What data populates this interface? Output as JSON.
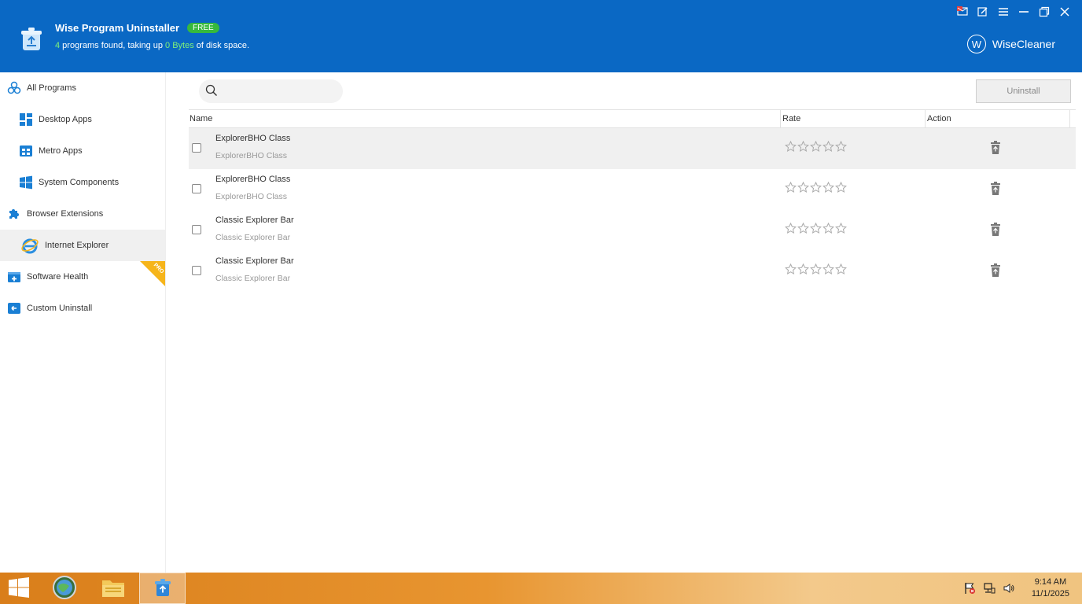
{
  "header": {
    "title": "Wise Program Uninstaller",
    "badge": "FREE",
    "subtitle_count": "4",
    "subtitle_mid": " programs found, taking up ",
    "subtitle_size": "0 Bytes",
    "subtitle_end": " of disk space.",
    "brand": "WiseCleaner",
    "brand_letter": "W"
  },
  "sidebar": {
    "items": [
      {
        "label": "All Programs",
        "icon": "cubes-icon"
      },
      {
        "label": "Desktop Apps",
        "icon": "desktop-apps-icon"
      },
      {
        "label": "Metro Apps",
        "icon": "metro-apps-icon"
      },
      {
        "label": "System Components",
        "icon": "windows-icon"
      },
      {
        "label": "Browser Extensions",
        "icon": "puzzle-icon"
      },
      {
        "label": "Internet Explorer",
        "icon": "ie-icon"
      },
      {
        "label": "Software Health",
        "icon": "health-icon"
      },
      {
        "label": "Custom Uninstall",
        "icon": "custom-uninstall-icon"
      }
    ],
    "pro_badge": "PRO"
  },
  "toolbar": {
    "search_placeholder": "",
    "uninstall_label": "Uninstall"
  },
  "table": {
    "headers": {
      "name": "Name",
      "rate": "Rate",
      "action": "Action"
    },
    "rows": [
      {
        "name": "ExplorerBHO Class",
        "sub": "ExplorerBHO Class",
        "rating": 0
      },
      {
        "name": "ExplorerBHO Class",
        "sub": "ExplorerBHO Class",
        "rating": 0
      },
      {
        "name": "Classic Explorer Bar",
        "sub": "Classic Explorer Bar",
        "rating": 0
      },
      {
        "name": "Classic Explorer Bar",
        "sub": "Classic Explorer Bar",
        "rating": 0
      }
    ]
  },
  "taskbar": {
    "time": "9:14 AM",
    "date": "11/1/2025"
  },
  "colors": {
    "header_bg": "#0a68c4",
    "badge_green": "#36b93d",
    "accent_blue": "#1a7fd4",
    "pro_orange": "#f6b51b"
  }
}
